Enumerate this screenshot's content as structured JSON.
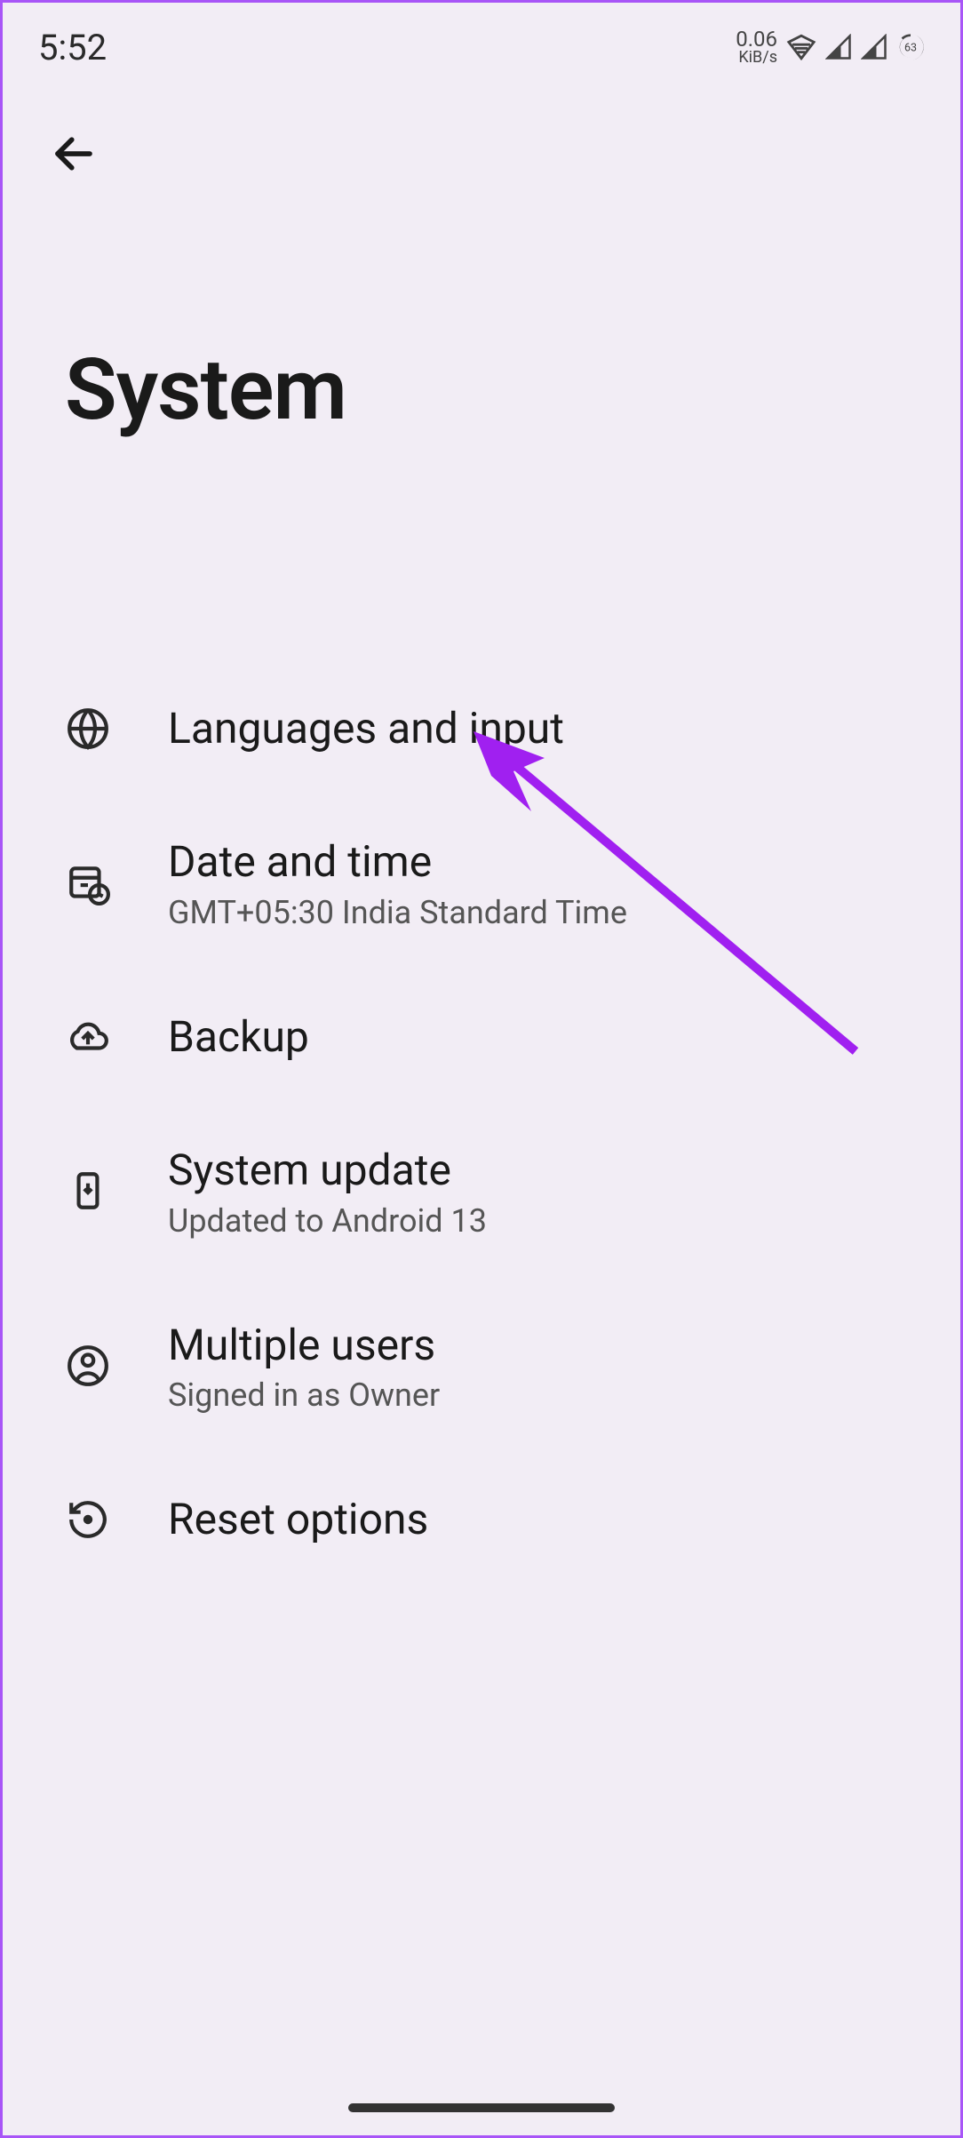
{
  "status": {
    "time": "5:52",
    "speed_value": "0.06",
    "speed_unit": "KiB/s",
    "battery": "63"
  },
  "page": {
    "title": "System"
  },
  "items": [
    {
      "label": "Languages and input",
      "sub": ""
    },
    {
      "label": "Date and time",
      "sub": "GMT+05:30 India Standard Time"
    },
    {
      "label": "Backup",
      "sub": ""
    },
    {
      "label": "System update",
      "sub": "Updated to Android 13"
    },
    {
      "label": "Multiple users",
      "sub": "Signed in as Owner"
    },
    {
      "label": "Reset options",
      "sub": ""
    }
  ]
}
